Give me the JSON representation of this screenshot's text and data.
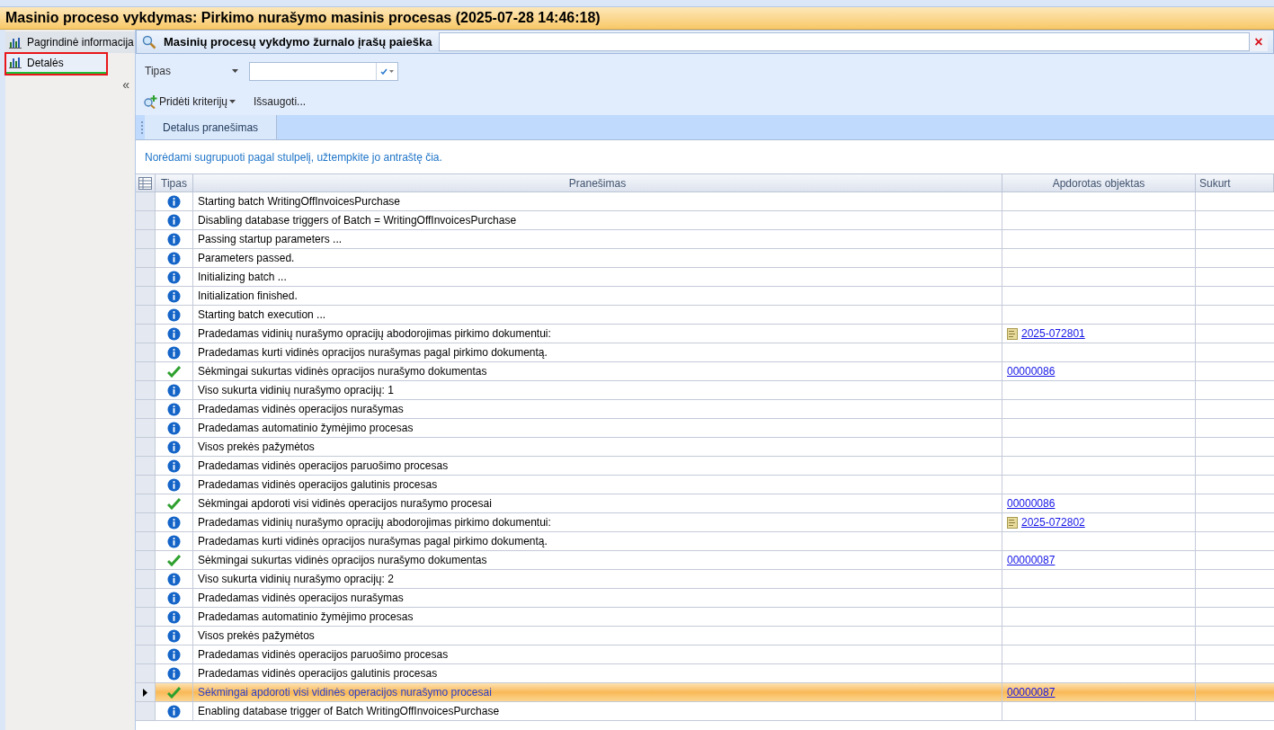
{
  "window": {
    "title": "Masinio proceso vykdymas: Pirkimo nurašymo masinis procesas (2025-07-28 14:46:18)"
  },
  "sidebar": {
    "items": [
      {
        "label": "Pagrindinė informacija",
        "selected": false,
        "highlighted": false
      },
      {
        "label": "Detalės",
        "selected": true,
        "highlighted": true
      }
    ],
    "collapse": "«"
  },
  "search": {
    "title": "Masinių procesų vykdymo žurnalo įrašų paieška",
    "clear": "×"
  },
  "filter": {
    "label": "Tipas"
  },
  "toolbar": {
    "add_criteria": "Pridėti kriterijų",
    "save": "Išsaugoti..."
  },
  "tabs": [
    {
      "label": "Detalus pranešimas",
      "selected": true
    }
  ],
  "group_hint": "Norėdami sugrupuoti pagal stulpelį, užtempkite jo antraštę čia.",
  "table": {
    "columns": [
      "Tipas",
      "Pranešimas",
      "Apdorotas objektas",
      "Sukurt"
    ],
    "rows": [
      {
        "kind": "info",
        "message": "Starting batch WritingOffInvoicesPurchase",
        "selected": false
      },
      {
        "kind": "info",
        "message": "Disabling database triggers of Batch = WritingOffInvoicesPurchase",
        "selected": false
      },
      {
        "kind": "info",
        "message": "Passing startup parameters ...",
        "selected": false
      },
      {
        "kind": "info",
        "message": "Parameters passed.",
        "selected": false
      },
      {
        "kind": "info",
        "message": "Initializing batch ...",
        "selected": false
      },
      {
        "kind": "info",
        "message": "Initialization finished.",
        "selected": false
      },
      {
        "kind": "info",
        "message": "Starting batch execution ...",
        "selected": false
      },
      {
        "kind": "info",
        "message": "Pradedamas vidinių nurašymo opracijų abodorojimas pirkimo dokumentui:",
        "object": "2025-072801",
        "object_icon": true,
        "selected": false
      },
      {
        "kind": "info",
        "message": "Pradedamas kurti vidinės opracijos nurašymas pagal pirkimo dokumentą.",
        "selected": false
      },
      {
        "kind": "success",
        "message": "Sėkmingai sukurtas vidinės opracijos nurašymo dokumentas",
        "object": "00000086",
        "object_icon": false,
        "selected": false
      },
      {
        "kind": "info",
        "message": "Viso sukurta vidinių nurašymo opracijų: 1",
        "selected": false
      },
      {
        "kind": "info",
        "message": "Pradedamas vidinės operacijos nurašymas",
        "selected": false
      },
      {
        "kind": "info",
        "message": "Pradedamas automatinio žymėjimo procesas",
        "selected": false
      },
      {
        "kind": "info",
        "message": "Visos prekės pažymėtos",
        "selected": false
      },
      {
        "kind": "info",
        "message": "Pradedamas vidinės operacijos paruošimo procesas",
        "selected": false
      },
      {
        "kind": "info",
        "message": "Pradedamas vidinės operacijos galutinis procesas",
        "selected": false
      },
      {
        "kind": "success",
        "message": "Sėkmingai apdoroti visi vidinės operacijos nurašymo procesai",
        "object": "00000086",
        "object_icon": false,
        "selected": false
      },
      {
        "kind": "info",
        "message": "Pradedamas vidinių nurašymo opracijų abodorojimas pirkimo dokumentui:",
        "object": "2025-072802",
        "object_icon": true,
        "selected": false
      },
      {
        "kind": "info",
        "message": "Pradedamas kurti vidinės opracijos nurašymas pagal pirkimo dokumentą.",
        "selected": false
      },
      {
        "kind": "success",
        "message": "Sėkmingai sukurtas vidinės opracijos nurašymo dokumentas",
        "object": "00000087",
        "object_icon": false,
        "selected": false
      },
      {
        "kind": "info",
        "message": "Viso sukurta vidinių nurašymo opracijų: 2",
        "selected": false
      },
      {
        "kind": "info",
        "message": "Pradedamas vidinės operacijos nurašymas",
        "selected": false
      },
      {
        "kind": "info",
        "message": "Pradedamas automatinio žymėjimo procesas",
        "selected": false
      },
      {
        "kind": "info",
        "message": "Visos prekės pažymėtos",
        "selected": false
      },
      {
        "kind": "info",
        "message": "Pradedamas vidinės operacijos paruošimo procesas",
        "selected": false
      },
      {
        "kind": "info",
        "message": "Pradedamas vidinės operacijos galutinis procesas",
        "selected": false
      },
      {
        "kind": "success",
        "message": "Sėkmingai apdoroti visi vidinės operacijos nurašymo procesai",
        "object": "00000087",
        "object_icon": false,
        "selected": true
      },
      {
        "kind": "info",
        "message": "Enabling database trigger of Batch WritingOffInvoicesPurchase",
        "selected": false
      }
    ]
  }
}
